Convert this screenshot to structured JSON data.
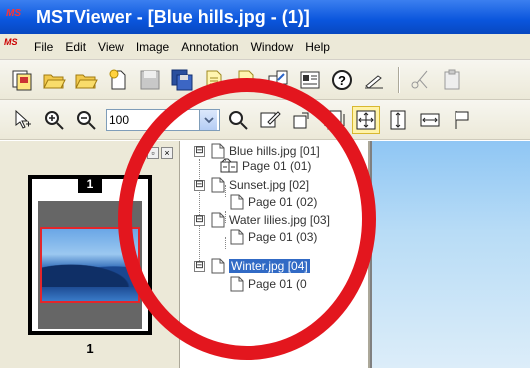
{
  "window": {
    "title": "MSTViewer - [Blue hills.jpg - (1)]",
    "app_badge": "MS"
  },
  "menu": {
    "items": [
      "File",
      "Edit",
      "View",
      "Image",
      "Annotation",
      "Window",
      "Help"
    ]
  },
  "toolbar1": {
    "icons": [
      "scan-icon",
      "open-folder-icon",
      "open-folder-icon",
      "new-file-icon",
      "save-icon",
      "save-all-icon",
      "copy-page-icon",
      "paste-page-icon",
      "duplicate-icon",
      "properties-icon",
      "help-icon",
      "edit-icon",
      "cut-icon",
      "clipboard-icon"
    ]
  },
  "toolbar2": {
    "zoom_value": "100",
    "icons": [
      "pointer-icon",
      "zoom-in-icon",
      "zoom-out-icon",
      "zoom-magnify-icon",
      "note-icon",
      "rotate-icon",
      "fit-page-icon",
      "fit-best-icon",
      "fit-height-icon",
      "fit-width-icon",
      "flag-icon"
    ]
  },
  "thumbnail": {
    "badge": "1",
    "label": "1"
  },
  "tree": {
    "items": [
      {
        "name": "Blue hills.jpg [01]",
        "page": "Page 01 (01)",
        "expander": "⊟"
      },
      {
        "name": "Sunset.jpg [02]",
        "page": "Page 01 (02)",
        "expander": "⊟"
      },
      {
        "name": "Water lilies.jpg [03]",
        "page": "Page 01 (03)",
        "expander": "⊟"
      },
      {
        "name": "Winter.jpg [04]",
        "page": "Page 01 (0",
        "expander": "⊟",
        "selected": true
      }
    ]
  },
  "colors": {
    "titlebar": "#0a55dc",
    "annotation": "#e3161e",
    "selection": "#316ac5"
  }
}
